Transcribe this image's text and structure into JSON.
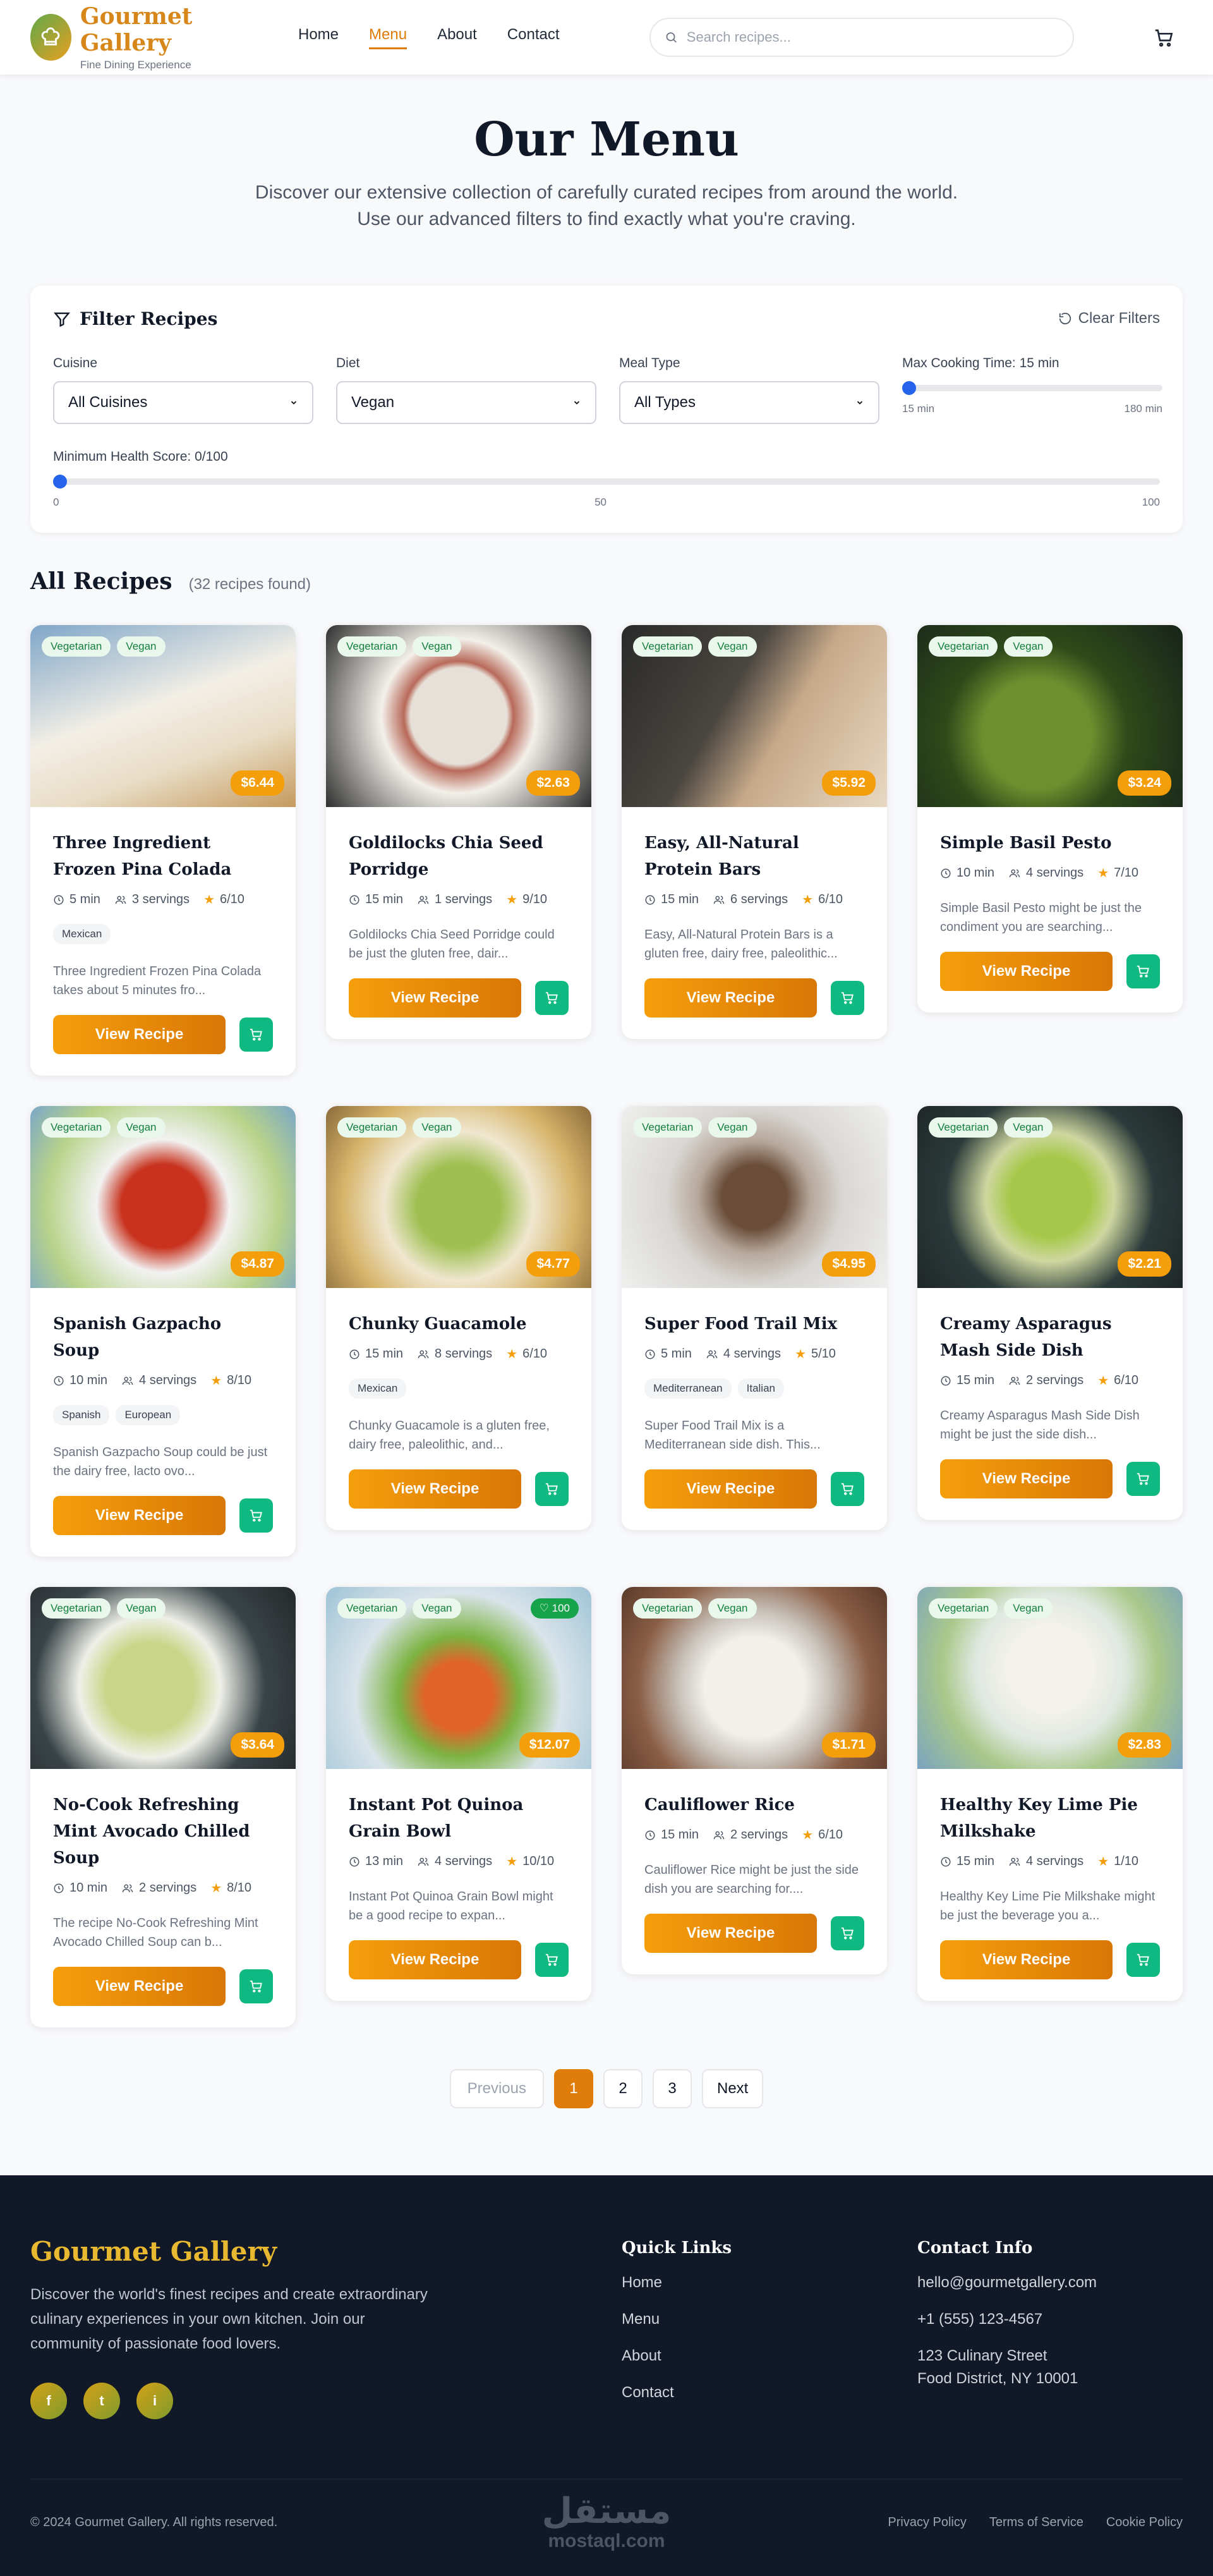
{
  "header": {
    "brand": "Gourmet Gallery",
    "tagline": "Fine Dining Experience",
    "nav": [
      "Home",
      "Menu",
      "About",
      "Contact"
    ],
    "active_nav": "Menu",
    "search_placeholder": "Search recipes..."
  },
  "hero": {
    "title": "Our Menu",
    "subtitle": "Discover our extensive collection of carefully curated recipes from around the world. Use our advanced filters to find exactly what you're craving."
  },
  "filters": {
    "title": "Filter Recipes",
    "clear_label": "Clear Filters",
    "cuisine": {
      "label": "Cuisine",
      "value": "All Cuisines"
    },
    "diet": {
      "label": "Diet",
      "value": "Vegan"
    },
    "meal_type": {
      "label": "Meal Type",
      "value": "All Types"
    },
    "max_time": {
      "label": "Max Cooking Time: 15 min",
      "value": 15,
      "min_label": "15 min",
      "max_label": "180 min"
    },
    "health": {
      "label": "Minimum Health Score: 0/100",
      "value": 0,
      "ticks": [
        "0",
        "50",
        "100"
      ]
    }
  },
  "recipes_section": {
    "title": "All Recipes",
    "count": "(32 recipes found)"
  },
  "recipes": [
    {
      "title": "Three Ingredient Frozen Pina Colada",
      "price": "$6.44",
      "time": "5 min",
      "servings": "3 servings",
      "score": "6/10",
      "cuisines": [
        "Mexican"
      ],
      "desc": "Three Ingredient Frozen Pina Colada takes about 5 minutes fro...",
      "tags": [
        "Vegetarian",
        "Vegan"
      ]
    },
    {
      "title": "Goldilocks Chia Seed Porridge",
      "price": "$2.63",
      "time": "15 min",
      "servings": "1 servings",
      "score": "9/10",
      "cuisines": [],
      "desc": "Goldilocks Chia Seed Porridge could be just the gluten free, dair...",
      "tags": [
        "Vegetarian",
        "Vegan"
      ]
    },
    {
      "title": "Easy, All-Natural Protein Bars",
      "price": "$5.92",
      "time": "15 min",
      "servings": "6 servings",
      "score": "6/10",
      "cuisines": [],
      "desc": "Easy, All-Natural Protein Bars is a gluten free, dairy free, paleolithic...",
      "tags": [
        "Vegetarian",
        "Vegan"
      ]
    },
    {
      "title": "Simple Basil Pesto",
      "price": "$3.24",
      "time": "10 min",
      "servings": "4 servings",
      "score": "7/10",
      "cuisines": [],
      "desc": "Simple Basil Pesto might be just the condiment you are searching...",
      "tags": [
        "Vegetarian",
        "Vegan"
      ]
    },
    {
      "title": "Spanish Gazpacho Soup",
      "price": "$4.87",
      "time": "10 min",
      "servings": "4 servings",
      "score": "8/10",
      "cuisines": [
        "Spanish",
        "European"
      ],
      "desc": "Spanish Gazpacho Soup could be just the dairy free, lacto ovo...",
      "tags": [
        "Vegetarian",
        "Vegan"
      ]
    },
    {
      "title": "Chunky Guacamole",
      "price": "$4.77",
      "time": "15 min",
      "servings": "8 servings",
      "score": "6/10",
      "cuisines": [
        "Mexican"
      ],
      "desc": "Chunky Guacamole is a gluten free, dairy free, paleolithic, and...",
      "tags": [
        "Vegetarian",
        "Vegan"
      ]
    },
    {
      "title": "Super Food Trail Mix",
      "price": "$4.95",
      "time": "5 min",
      "servings": "4 servings",
      "score": "5/10",
      "cuisines": [
        "Mediterranean",
        "Italian"
      ],
      "desc": "Super Food Trail Mix is a Mediterranean side dish. This...",
      "tags": [
        "Vegetarian",
        "Vegan"
      ]
    },
    {
      "title": "Creamy Asparagus Mash Side Dish",
      "price": "$2.21",
      "time": "15 min",
      "servings": "2 servings",
      "score": "6/10",
      "cuisines": [],
      "desc": "Creamy Asparagus Mash Side Dish might be just the side dish...",
      "tags": [
        "Vegetarian",
        "Vegan"
      ]
    },
    {
      "title": "No-Cook Refreshing Mint Avocado Chilled Soup",
      "price": "$3.64",
      "time": "10 min",
      "servings": "2 servings",
      "score": "8/10",
      "cuisines": [],
      "desc": "The recipe No-Cook Refreshing Mint Avocado Chilled Soup can b...",
      "tags": [
        "Vegetarian",
        "Vegan"
      ]
    },
    {
      "title": "Instant Pot Quinoa Grain Bowl",
      "price": "$12.07",
      "time": "13 min",
      "servings": "4 servings",
      "score": "10/10",
      "cuisines": [],
      "desc": "Instant Pot Quinoa Grain Bowl might be a good recipe to expan...",
      "tags": [
        "Vegetarian",
        "Vegan"
      ],
      "health_badge": "100"
    },
    {
      "title": "Cauliflower Rice",
      "price": "$1.71",
      "time": "15 min",
      "servings": "2 servings",
      "score": "6/10",
      "cuisines": [],
      "desc": "Cauliflower Rice might be just the side dish you are searching for....",
      "tags": [
        "Vegetarian",
        "Vegan"
      ]
    },
    {
      "title": "Healthy Key Lime Pie Milkshake",
      "price": "$2.83",
      "time": "15 min",
      "servings": "4 servings",
      "score": "1/10",
      "cuisines": [],
      "desc": "Healthy Key Lime Pie Milkshake might be just the beverage you a...",
      "tags": [
        "Vegetarian",
        "Vegan"
      ]
    }
  ],
  "card_labels": {
    "view": "View Recipe"
  },
  "pagination": {
    "previous": "Previous",
    "pages": [
      "1",
      "2",
      "3"
    ],
    "current": "1",
    "next": "Next"
  },
  "footer": {
    "brand": "Gourmet Gallery",
    "about": "Discover the world's finest recipes and create extraordinary culinary experiences in your own kitchen. Join our community of passionate food lovers.",
    "socials": [
      "f",
      "t",
      "i"
    ],
    "quick_links_title": "Quick Links",
    "quick_links": [
      "Home",
      "Menu",
      "About",
      "Contact"
    ],
    "contact_title": "Contact Info",
    "email": "hello@gourmetgallery.com",
    "phone": "+1 (555) 123-4567",
    "address_line1": "123 Culinary Street",
    "address_line2": "Food District, NY 10001",
    "copyright": "© 2024 Gourmet Gallery. All rights reserved.",
    "legal": [
      "Privacy Policy",
      "Terms of Service",
      "Cookie Policy"
    ],
    "watermark_ar": "مستقل",
    "watermark_en": "mostaql.com"
  },
  "colors": {
    "accent": "#e07c0a",
    "price": "#f59e0b",
    "cart": "#10b981",
    "footer_bg": "#111827",
    "brand_gold": "#e8b830"
  }
}
